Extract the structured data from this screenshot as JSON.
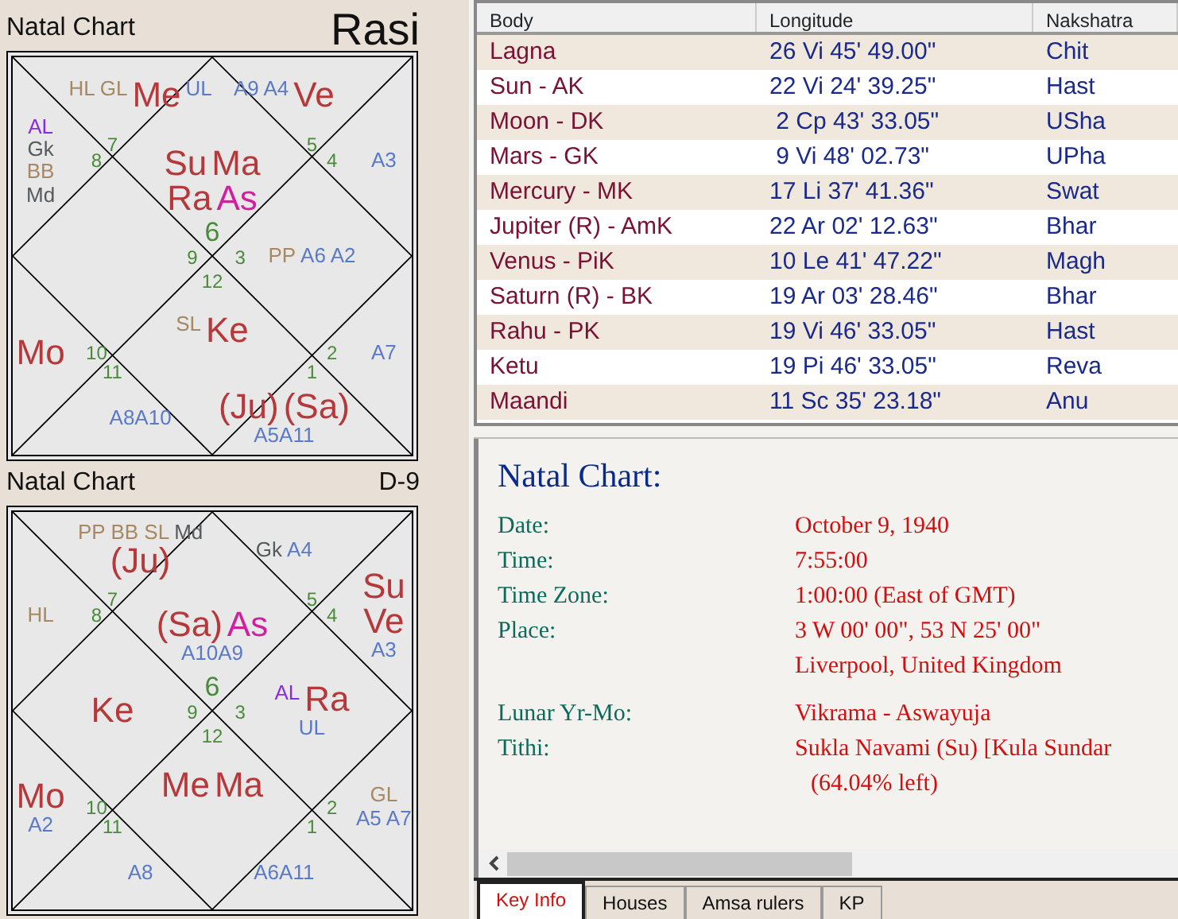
{
  "charts": [
    {
      "title": "Natal Chart",
      "name": "Rasi",
      "regions": [
        {
          "sign": "6",
          "items": [
            {
              "text": "Su",
              "kind": "planet",
              "color": "#b5383a"
            },
            {
              "text": "Ma",
              "kind": "planet",
              "color": "#b5383a"
            },
            {
              "text": "Ra",
              "kind": "planet",
              "color": "#b5383a"
            },
            {
              "text": "As",
              "kind": "planet",
              "color": "#d020a0"
            }
          ]
        },
        {
          "sign": "7",
          "items": [
            {
              "text": "HL",
              "kind": "point",
              "color": "#a88860"
            },
            {
              "text": "GL",
              "kind": "point",
              "color": "#a88860"
            },
            {
              "text": "Me",
              "kind": "planet",
              "color": "#b5383a"
            },
            {
              "text": "UL",
              "kind": "point",
              "color": "#5a7ac8"
            }
          ]
        },
        {
          "sign": "8",
          "items": [
            {
              "text": "AL",
              "kind": "point",
              "color": "#8a2be2"
            },
            {
              "text": "Gk",
              "kind": "point",
              "color": "#555a5a"
            },
            {
              "text": "BB",
              "kind": "point",
              "color": "#a88860"
            },
            {
              "text": "Md",
              "kind": "point",
              "color": "#555a5a"
            }
          ]
        },
        {
          "sign": "9"
        },
        {
          "sign": "10",
          "items": [
            {
              "text": "Mo",
              "kind": "planet",
              "color": "#b5383a"
            }
          ]
        },
        {
          "sign": "11",
          "items": [
            {
              "text": "A8A10",
              "kind": "point",
              "color": "#5a7ac8"
            }
          ]
        },
        {
          "sign": "12",
          "items": [
            {
              "text": "SL",
              "kind": "point",
              "color": "#a88860"
            },
            {
              "text": "Ke",
              "kind": "planet",
              "color": "#b5383a"
            }
          ]
        },
        {
          "sign": "1",
          "items": [
            {
              "text": "(Ju)",
              "kind": "planet",
              "color": "#b5383a"
            },
            {
              "text": "(Sa)",
              "kind": "planet",
              "color": "#b5383a"
            },
            {
              "text": "A5A11",
              "kind": "point",
              "color": "#5a7ac8"
            }
          ]
        },
        {
          "sign": "2",
          "items": [
            {
              "text": "A7",
              "kind": "point",
              "color": "#5a7ac8"
            }
          ]
        },
        {
          "sign": "3",
          "items": [
            {
              "text": "PP",
              "kind": "point",
              "color": "#a88860"
            },
            {
              "text": "A6 A2",
              "kind": "point",
              "color": "#5a7ac8"
            }
          ]
        },
        {
          "sign": "4",
          "items": [
            {
              "text": "A3",
              "kind": "point",
              "color": "#5a7ac8"
            }
          ]
        },
        {
          "sign": "5",
          "items": [
            {
              "text": "A9 A4",
              "kind": "point",
              "color": "#5a7ac8"
            },
            {
              "text": "Ve",
              "kind": "planet",
              "color": "#b5383a"
            }
          ]
        }
      ]
    },
    {
      "title": "Natal Chart",
      "name": "D-9",
      "regions": [
        {
          "sign": "6",
          "items": [
            {
              "text": "(Sa)",
              "kind": "planet",
              "color": "#b5383a"
            },
            {
              "text": "As",
              "kind": "planet",
              "color": "#d020a0"
            },
            {
              "text": "A10A9",
              "kind": "point",
              "color": "#5a7ac8"
            }
          ]
        },
        {
          "sign": "7",
          "items": [
            {
              "text": "PP BB SL",
              "kind": "point",
              "color": "#a88860"
            },
            {
              "text": "Md",
              "kind": "point",
              "color": "#555a5a"
            },
            {
              "text": "(Ju)",
              "kind": "planet",
              "color": "#b5383a"
            }
          ]
        },
        {
          "sign": "8",
          "items": [
            {
              "text": "HL",
              "kind": "point",
              "color": "#a88860"
            }
          ]
        },
        {
          "sign": "9",
          "items": [
            {
              "text": "Ke",
              "kind": "planet",
              "color": "#b5383a"
            }
          ]
        },
        {
          "sign": "10",
          "items": [
            {
              "text": "Mo",
              "kind": "planet",
              "color": "#b5383a"
            },
            {
              "text": "A2",
              "kind": "point",
              "color": "#5a7ac8"
            }
          ]
        },
        {
          "sign": "11",
          "items": [
            {
              "text": "A8",
              "kind": "point",
              "color": "#5a7ac8"
            }
          ]
        },
        {
          "sign": "12",
          "items": [
            {
              "text": "Me",
              "kind": "planet",
              "color": "#b5383a"
            },
            {
              "text": "Ma",
              "kind": "planet",
              "color": "#b5383a"
            }
          ]
        },
        {
          "sign": "1",
          "items": [
            {
              "text": "A6A11",
              "kind": "point",
              "color": "#5a7ac8"
            }
          ]
        },
        {
          "sign": "2",
          "items": [
            {
              "text": "GL",
              "kind": "point",
              "color": "#a88860"
            },
            {
              "text": "A5",
              "kind": "point",
              "color": "#5a7ac8"
            },
            {
              "text": "A7",
              "kind": "point",
              "color": "#5a7ac8"
            }
          ]
        },
        {
          "sign": "3",
          "items": [
            {
              "text": "AL",
              "kind": "point",
              "color": "#8a2be2"
            },
            {
              "text": "Ra",
              "kind": "planet",
              "color": "#b5383a"
            },
            {
              "text": "UL",
              "kind": "point",
              "color": "#5a7ac8"
            }
          ]
        },
        {
          "sign": "4",
          "items": [
            {
              "text": "Su",
              "kind": "planet",
              "color": "#b5383a"
            },
            {
              "text": "Ve",
              "kind": "planet",
              "color": "#b5383a"
            },
            {
              "text": "A3",
              "kind": "point",
              "color": "#5a7ac8"
            }
          ]
        },
        {
          "sign": "5",
          "items": [
            {
              "text": "Gk",
              "kind": "point",
              "color": "#555a5a"
            },
            {
              "text": "A4",
              "kind": "point",
              "color": "#5a7ac8"
            }
          ]
        }
      ]
    }
  ],
  "table": {
    "columns": [
      "Body",
      "Longitude",
      "Nakshatra"
    ],
    "rows": [
      [
        "Lagna",
        "26 Vi 45' 49.00\"",
        "Chit"
      ],
      [
        "Sun - AK",
        "22 Vi 24' 39.25\"",
        "Hast"
      ],
      [
        "Moon - DK",
        " 2 Cp 43' 33.05\"",
        "USha"
      ],
      [
        "Mars - GK",
        " 9 Vi 48' 02.73\"",
        "UPha"
      ],
      [
        "Mercury - MK",
        "17 Li 37' 41.36\"",
        "Swat"
      ],
      [
        "Jupiter (R) - AmK",
        "22 Ar 02' 12.63\"",
        "Bhar"
      ],
      [
        "Venus - PiK",
        "10 Le 41' 47.22\"",
        "Magh"
      ],
      [
        "Saturn (R) - BK",
        "19 Ar 03' 28.46\"",
        "Bhar"
      ],
      [
        "Rahu - PK",
        "19 Vi 46' 33.05\"",
        "Hast"
      ],
      [
        "Ketu",
        "19 Pi 46' 33.05\"",
        "Reva"
      ],
      [
        "Maandi",
        "11 Sc 35' 23.18\"",
        "Anu"
      ]
    ]
  },
  "info": {
    "title": "Natal Chart:",
    "sections": [
      [
        {
          "label": "Date:",
          "values": [
            "October 9, 1940"
          ]
        },
        {
          "label": "Time:",
          "values": [
            "7:55:00"
          ]
        },
        {
          "label": "Time Zone:",
          "values": [
            "1:00:00 (East of GMT)"
          ]
        },
        {
          "label": "Place:",
          "values": [
            "3 W 00' 00\", 53 N 25' 00\"",
            "Liverpool, United Kingdom"
          ]
        }
      ],
      [
        {
          "label": "Lunar Yr-Mo:",
          "values": [
            "Vikrama - Aswayuja"
          ]
        },
        {
          "label": "Tithi:",
          "values": [
            "Sukla Navami (Su) [Kula Sundar",
            "(64.04% left)"
          ]
        }
      ]
    ]
  },
  "tabs": [
    {
      "label": "Key Info",
      "selected": true
    },
    {
      "label": "Houses",
      "selected": false
    },
    {
      "label": "Amsa rulers",
      "selected": false
    },
    {
      "label": "KP",
      "selected": false
    }
  ]
}
